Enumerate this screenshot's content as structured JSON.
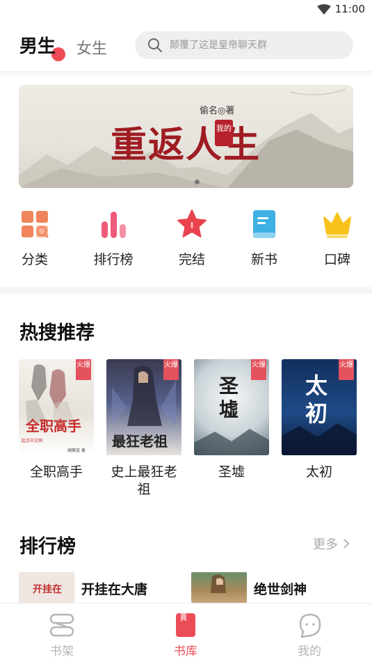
{
  "status_bar": {
    "time": "11:00"
  },
  "header": {
    "tabs": [
      {
        "label": "男生"
      },
      {
        "label": "女生"
      }
    ],
    "search": {
      "placeholder": "颠覆了这是皇帝聊天群"
    }
  },
  "banner": {
    "author": "偷名◎著",
    "seal": "我的",
    "title": "重返人生"
  },
  "categories": [
    {
      "label": "分类",
      "icon": "grid-search-icon",
      "color": "#f0845a"
    },
    {
      "label": "排行榜",
      "icon": "bar-chart-icon",
      "color": "#ef5a7a"
    },
    {
      "label": "完结",
      "icon": "star-icon",
      "color": "#e8434e"
    },
    {
      "label": "新书",
      "icon": "book-icon",
      "color": "#3db0e4"
    },
    {
      "label": "口碑",
      "icon": "crown-icon",
      "color": "#f8c21a"
    }
  ],
  "hot_search": {
    "title": "热搜推荐",
    "books": [
      {
        "name": "全职高手",
        "cover_title": "全职高手",
        "badge": "火爆",
        "publisher": "起点中文网",
        "cover_author": "蝴蝶蓝 著"
      },
      {
        "name": "史上最狂老祖",
        "cover_title": "最狂老祖",
        "badge": "火爆"
      },
      {
        "name": "圣墟",
        "cover_title": "圣墟",
        "badge": "火爆"
      },
      {
        "name": "太初",
        "cover_title": "太初",
        "badge": "火爆"
      }
    ]
  },
  "ranking": {
    "title": "排行榜",
    "more_label": "更多",
    "items": [
      {
        "name": "开挂在大唐",
        "thumb_text": "开挂在"
      },
      {
        "name": "绝世剑神"
      }
    ]
  },
  "bottom_nav": [
    {
      "label": "书架",
      "icon": "bookshelf-icon",
      "active": false
    },
    {
      "label": "书库",
      "icon": "library-icon",
      "active": true
    },
    {
      "label": "我的",
      "icon": "profile-icon",
      "active": false
    }
  ],
  "colors": {
    "accent": "#ec4c58",
    "muted": "#b5b5b5"
  }
}
